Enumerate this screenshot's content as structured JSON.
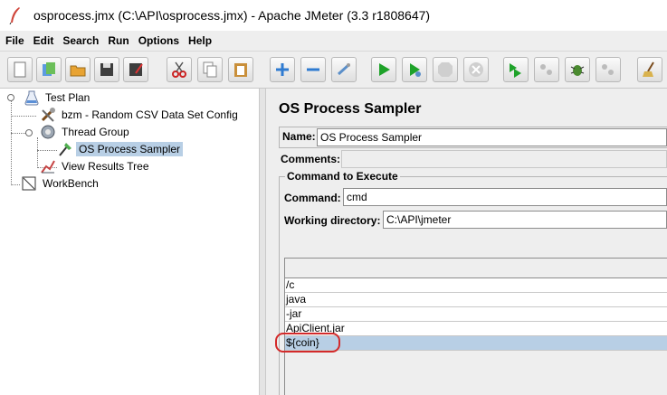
{
  "window": {
    "title": "osprocess.jmx (C:\\API\\osprocess.jmx) - Apache JMeter (3.3 r1808647)"
  },
  "menu": [
    "File",
    "Edit",
    "Search",
    "Run",
    "Options",
    "Help"
  ],
  "toolbar": {
    "buttons": [
      "new-icon",
      "templates-icon",
      "open-icon",
      "save-icon",
      "save-as-icon",
      "cut-icon",
      "copy-icon",
      "paste-icon",
      "expand-icon",
      "collapse-icon",
      "toggle-icon",
      "start-icon",
      "start-no-pause-icon",
      "stop-icon",
      "shutdown-icon",
      "remote-start-icon",
      "remote-stop-icon",
      "remote-exit-icon",
      "clear-icon"
    ]
  },
  "tree": {
    "items": [
      {
        "label": "Test Plan",
        "icon": "test-plan-icon"
      },
      {
        "label": "bzm - Random CSV Data Set Config",
        "icon": "config-element-icon"
      },
      {
        "label": "Thread Group",
        "icon": "thread-group-icon"
      },
      {
        "label": "OS Process Sampler",
        "icon": "sampler-icon",
        "selected": true
      },
      {
        "label": "View Results Tree",
        "icon": "listener-icon"
      },
      {
        "label": "WorkBench",
        "icon": "workbench-icon"
      }
    ]
  },
  "panel": {
    "title": "OS Process Sampler",
    "name_label": "Name:",
    "name_value": "OS Process Sampler",
    "comments_label": "Comments:",
    "comments_value": "",
    "command_group_title": "Command to Execute",
    "command_label": "Command:",
    "command_value": "cmd",
    "working_dir_label": "Working directory:",
    "working_dir_value": "C:\\API\\jmeter",
    "arguments": [
      "/c",
      "java",
      "-jar",
      "ApiClient.jar",
      "${coin}"
    ],
    "selected_argument": "${coin}"
  },
  "colors": {
    "selection": "#b8cfe5",
    "annotation": "#d32a2a"
  }
}
